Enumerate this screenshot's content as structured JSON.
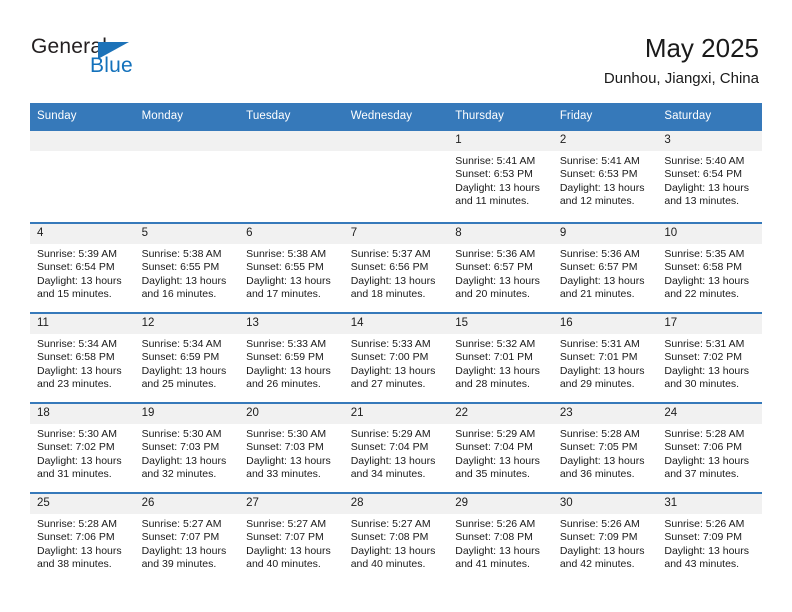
{
  "logo": {
    "word_top": "General",
    "word_bottom": "Blue",
    "accent_color": "#1c72b8",
    "triangle_icon": "triangle-icon"
  },
  "header": {
    "title": "May 2025",
    "subtitle": "Dunhou, Jiangxi, China"
  },
  "theme": {
    "header_blue": "#3679ba",
    "daynum_gray": "#f1f1f1",
    "text": "#1a1a1a"
  },
  "calendar": {
    "weekday_headers": [
      "Sunday",
      "Monday",
      "Tuesday",
      "Wednesday",
      "Thursday",
      "Friday",
      "Saturday"
    ],
    "labels": {
      "sunrise": "Sunrise:",
      "sunset": "Sunset:",
      "daylight": "Daylight:"
    },
    "weeks": [
      [
        {
          "day": "",
          "blank": true
        },
        {
          "day": "",
          "blank": true
        },
        {
          "day": "",
          "blank": true
        },
        {
          "day": "",
          "blank": true
        },
        {
          "day": "1",
          "sunrise": "Sunrise: 5:41 AM",
          "sunset": "Sunset: 6:53 PM",
          "daylight_1": "Daylight: 13 hours",
          "daylight_2": "and 11 minutes."
        },
        {
          "day": "2",
          "sunrise": "Sunrise: 5:41 AM",
          "sunset": "Sunset: 6:53 PM",
          "daylight_1": "Daylight: 13 hours",
          "daylight_2": "and 12 minutes."
        },
        {
          "day": "3",
          "sunrise": "Sunrise: 5:40 AM",
          "sunset": "Sunset: 6:54 PM",
          "daylight_1": "Daylight: 13 hours",
          "daylight_2": "and 13 minutes."
        }
      ],
      [
        {
          "day": "4",
          "sunrise": "Sunrise: 5:39 AM",
          "sunset": "Sunset: 6:54 PM",
          "daylight_1": "Daylight: 13 hours",
          "daylight_2": "and 15 minutes."
        },
        {
          "day": "5",
          "sunrise": "Sunrise: 5:38 AM",
          "sunset": "Sunset: 6:55 PM",
          "daylight_1": "Daylight: 13 hours",
          "daylight_2": "and 16 minutes."
        },
        {
          "day": "6",
          "sunrise": "Sunrise: 5:38 AM",
          "sunset": "Sunset: 6:55 PM",
          "daylight_1": "Daylight: 13 hours",
          "daylight_2": "and 17 minutes."
        },
        {
          "day": "7",
          "sunrise": "Sunrise: 5:37 AM",
          "sunset": "Sunset: 6:56 PM",
          "daylight_1": "Daylight: 13 hours",
          "daylight_2": "and 18 minutes."
        },
        {
          "day": "8",
          "sunrise": "Sunrise: 5:36 AM",
          "sunset": "Sunset: 6:57 PM",
          "daylight_1": "Daylight: 13 hours",
          "daylight_2": "and 20 minutes."
        },
        {
          "day": "9",
          "sunrise": "Sunrise: 5:36 AM",
          "sunset": "Sunset: 6:57 PM",
          "daylight_1": "Daylight: 13 hours",
          "daylight_2": "and 21 minutes."
        },
        {
          "day": "10",
          "sunrise": "Sunrise: 5:35 AM",
          "sunset": "Sunset: 6:58 PM",
          "daylight_1": "Daylight: 13 hours",
          "daylight_2": "and 22 minutes."
        }
      ],
      [
        {
          "day": "11",
          "sunrise": "Sunrise: 5:34 AM",
          "sunset": "Sunset: 6:58 PM",
          "daylight_1": "Daylight: 13 hours",
          "daylight_2": "and 23 minutes."
        },
        {
          "day": "12",
          "sunrise": "Sunrise: 5:34 AM",
          "sunset": "Sunset: 6:59 PM",
          "daylight_1": "Daylight: 13 hours",
          "daylight_2": "and 25 minutes."
        },
        {
          "day": "13",
          "sunrise": "Sunrise: 5:33 AM",
          "sunset": "Sunset: 6:59 PM",
          "daylight_1": "Daylight: 13 hours",
          "daylight_2": "and 26 minutes."
        },
        {
          "day": "14",
          "sunrise": "Sunrise: 5:33 AM",
          "sunset": "Sunset: 7:00 PM",
          "daylight_1": "Daylight: 13 hours",
          "daylight_2": "and 27 minutes."
        },
        {
          "day": "15",
          "sunrise": "Sunrise: 5:32 AM",
          "sunset": "Sunset: 7:01 PM",
          "daylight_1": "Daylight: 13 hours",
          "daylight_2": "and 28 minutes."
        },
        {
          "day": "16",
          "sunrise": "Sunrise: 5:31 AM",
          "sunset": "Sunset: 7:01 PM",
          "daylight_1": "Daylight: 13 hours",
          "daylight_2": "and 29 minutes."
        },
        {
          "day": "17",
          "sunrise": "Sunrise: 5:31 AM",
          "sunset": "Sunset: 7:02 PM",
          "daylight_1": "Daylight: 13 hours",
          "daylight_2": "and 30 minutes."
        }
      ],
      [
        {
          "day": "18",
          "sunrise": "Sunrise: 5:30 AM",
          "sunset": "Sunset: 7:02 PM",
          "daylight_1": "Daylight: 13 hours",
          "daylight_2": "and 31 minutes."
        },
        {
          "day": "19",
          "sunrise": "Sunrise: 5:30 AM",
          "sunset": "Sunset: 7:03 PM",
          "daylight_1": "Daylight: 13 hours",
          "daylight_2": "and 32 minutes."
        },
        {
          "day": "20",
          "sunrise": "Sunrise: 5:30 AM",
          "sunset": "Sunset: 7:03 PM",
          "daylight_1": "Daylight: 13 hours",
          "daylight_2": "and 33 minutes."
        },
        {
          "day": "21",
          "sunrise": "Sunrise: 5:29 AM",
          "sunset": "Sunset: 7:04 PM",
          "daylight_1": "Daylight: 13 hours",
          "daylight_2": "and 34 minutes."
        },
        {
          "day": "22",
          "sunrise": "Sunrise: 5:29 AM",
          "sunset": "Sunset: 7:04 PM",
          "daylight_1": "Daylight: 13 hours",
          "daylight_2": "and 35 minutes."
        },
        {
          "day": "23",
          "sunrise": "Sunrise: 5:28 AM",
          "sunset": "Sunset: 7:05 PM",
          "daylight_1": "Daylight: 13 hours",
          "daylight_2": "and 36 minutes."
        },
        {
          "day": "24",
          "sunrise": "Sunrise: 5:28 AM",
          "sunset": "Sunset: 7:06 PM",
          "daylight_1": "Daylight: 13 hours",
          "daylight_2": "and 37 minutes."
        }
      ],
      [
        {
          "day": "25",
          "sunrise": "Sunrise: 5:28 AM",
          "sunset": "Sunset: 7:06 PM",
          "daylight_1": "Daylight: 13 hours",
          "daylight_2": "and 38 minutes."
        },
        {
          "day": "26",
          "sunrise": "Sunrise: 5:27 AM",
          "sunset": "Sunset: 7:07 PM",
          "daylight_1": "Daylight: 13 hours",
          "daylight_2": "and 39 minutes."
        },
        {
          "day": "27",
          "sunrise": "Sunrise: 5:27 AM",
          "sunset": "Sunset: 7:07 PM",
          "daylight_1": "Daylight: 13 hours",
          "daylight_2": "and 40 minutes."
        },
        {
          "day": "28",
          "sunrise": "Sunrise: 5:27 AM",
          "sunset": "Sunset: 7:08 PM",
          "daylight_1": "Daylight: 13 hours",
          "daylight_2": "and 40 minutes."
        },
        {
          "day": "29",
          "sunrise": "Sunrise: 5:26 AM",
          "sunset": "Sunset: 7:08 PM",
          "daylight_1": "Daylight: 13 hours",
          "daylight_2": "and 41 minutes."
        },
        {
          "day": "30",
          "sunrise": "Sunrise: 5:26 AM",
          "sunset": "Sunset: 7:09 PM",
          "daylight_1": "Daylight: 13 hours",
          "daylight_2": "and 42 minutes."
        },
        {
          "day": "31",
          "sunrise": "Sunrise: 5:26 AM",
          "sunset": "Sunset: 7:09 PM",
          "daylight_1": "Daylight: 13 hours",
          "daylight_2": "and 43 minutes."
        }
      ]
    ]
  }
}
